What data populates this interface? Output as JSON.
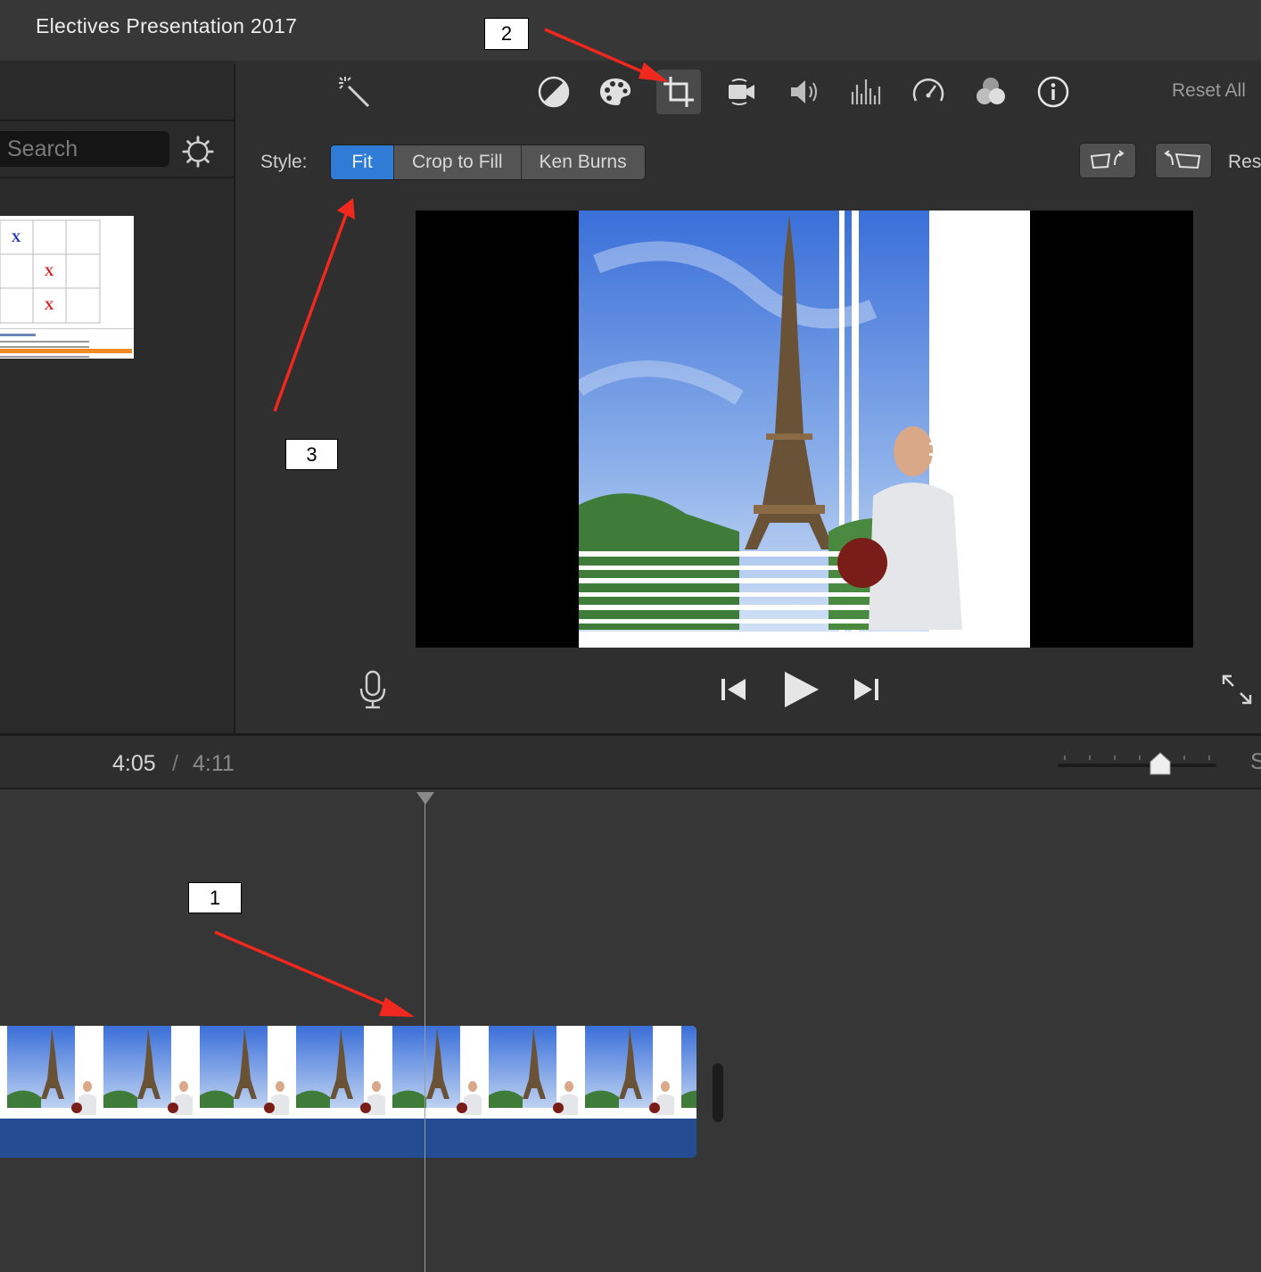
{
  "window": {
    "title": "Electives Presentation 2017"
  },
  "browser": {
    "search": {
      "placeholder": "Search",
      "value": ""
    },
    "thumbnail": {
      "cells": [
        "X",
        "",
        "",
        "",
        "X",
        "",
        "",
        "X",
        ""
      ]
    }
  },
  "toolbar": {
    "tools": [
      "magic-wand-icon",
      "color-balance-icon",
      "color-correction-icon",
      "crop-icon",
      "stabilization-icon",
      "volume-icon",
      "equalizer-icon",
      "speed-icon",
      "clip-filter-icon",
      "info-icon"
    ],
    "selected": "crop-icon",
    "reset_all": "Reset All"
  },
  "crop": {
    "style_label": "Style:",
    "options": [
      "Fit",
      "Crop to Fill",
      "Ken Burns"
    ],
    "selected": "Fit",
    "reset_partial": "Res"
  },
  "timeline": {
    "current_time": "4:05",
    "separator": "/",
    "total_time": "4:11",
    "zoom_fraction": 0.6,
    "partial_label": "S"
  },
  "annotations": {
    "tag1": "1",
    "tag2": "2",
    "tag3": "3"
  },
  "colors": {
    "accent": "#2f7bd6",
    "clip_audio": "#234c92",
    "arrow": "#f0281e"
  }
}
